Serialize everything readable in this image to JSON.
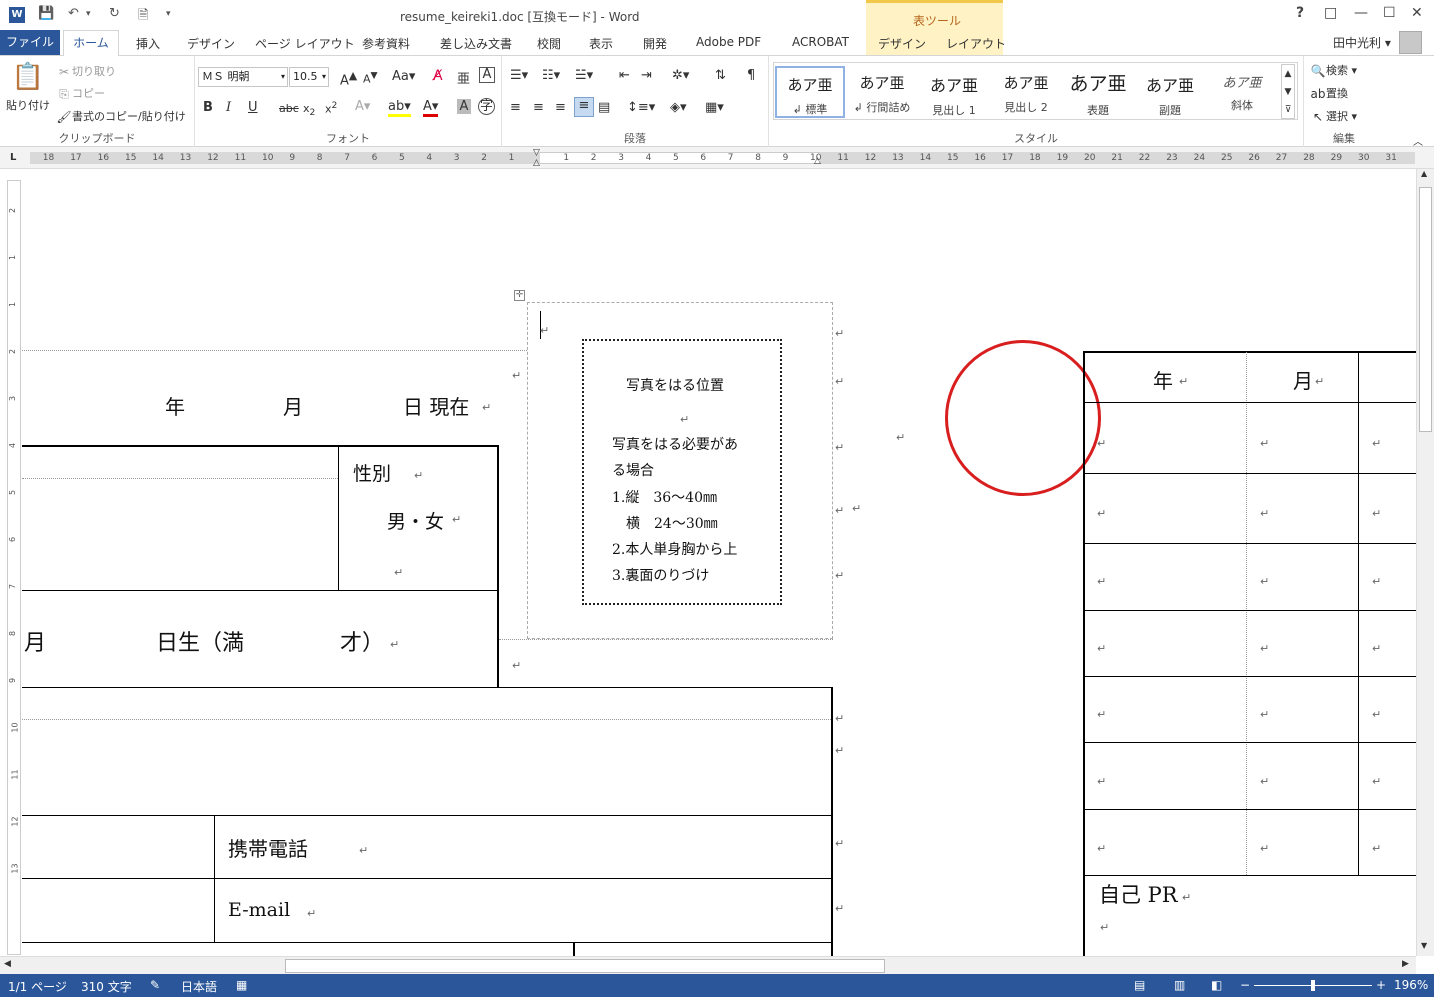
{
  "window": {
    "title": "resume_keireki1.doc [互換モード] - Word",
    "app_icon": "W",
    "controls": {
      "help": "?",
      "restore_ribbon": "□",
      "minimize": "—",
      "maximize": "☐",
      "close": "✕"
    }
  },
  "contextual": {
    "label": "表ツール"
  },
  "tabs": {
    "file": "ファイル",
    "home": "ホーム",
    "insert": "挿入",
    "design": "デザイン",
    "page_layout": "ページ レイアウト",
    "references": "参考資料",
    "mailings": "差し込み文書",
    "review": "校閲",
    "view": "表示",
    "developer": "開発",
    "adobe_pdf": "Adobe PDF",
    "acrobat": "ACROBAT",
    "table_design": "デザイン",
    "table_layout": "レイアウト",
    "user": "田中光利 ▾"
  },
  "ribbon": {
    "clipboard": {
      "paste": "貼り付け",
      "cut": "切り取り",
      "copy": "コピー",
      "format_painter": "書式のコピー/貼り付け",
      "label": "クリップボード"
    },
    "font": {
      "font_name": "ＭＳ 明朝",
      "font_size": "10.5",
      "label": "フォント"
    },
    "paragraph": {
      "label": "段落"
    },
    "styles": {
      "items": [
        {
          "sample": "あア亜",
          "name": "↲ 標準"
        },
        {
          "sample": "あア亜",
          "name": "↲ 行間詰め"
        },
        {
          "sample": "あア亜",
          "name": "見出し 1"
        },
        {
          "sample": "あア亜",
          "name": "見出し 2"
        },
        {
          "sample": "あア亜",
          "name": "表題"
        },
        {
          "sample": "あア亜",
          "name": "副題"
        },
        {
          "sample": "あア亜",
          "name": "斜体"
        }
      ],
      "label": "スタイル"
    },
    "editing": {
      "find": "検索",
      "replace": "置換",
      "select": "選択",
      "label": "編集"
    }
  },
  "ruler": {
    "h_left_ticks": [
      "18",
      "17",
      "16",
      "15",
      "14",
      "13",
      "12",
      "11",
      "10",
      "9",
      "8",
      "7",
      "6",
      "5",
      "4",
      "3",
      "2",
      "1"
    ],
    "h_right_ticks": [
      "1",
      "2",
      "3",
      "4",
      "5",
      "6",
      "7",
      "8",
      "9",
      "10",
      "11",
      "12",
      "13",
      "14",
      "15",
      "16",
      "17",
      "18",
      "19",
      "20",
      "21",
      "22",
      "23",
      "24",
      "25",
      "26",
      "27",
      "28",
      "29",
      "30",
      "31"
    ],
    "v_ticks": [
      "2",
      "1",
      "1",
      "2",
      "3",
      "4",
      "5",
      "6",
      "7",
      "8",
      "9",
      "10",
      "11",
      "12",
      "13"
    ]
  },
  "document": {
    "date_line": {
      "year": "年",
      "month": "月",
      "day": "日 現在"
    },
    "gender_label": "性別",
    "gender_value": "男・女",
    "birth_prefix": "月",
    "birth_text": "日生（満",
    "age_suffix": "才）",
    "mobile_label": "携帯電話",
    "email_label": "E-mail",
    "photo_box": {
      "title": "写真をはる位置",
      "line1": "写真をはる必要があ",
      "line2": "る場合",
      "line3": "1.縦　36～40㎜",
      "line4": "　横　24～30㎜",
      "line5": "2.本人単身胸から上",
      "line6": "3.裏面のりづけ"
    },
    "history_table": {
      "year_header": "年",
      "month_header": "月"
    },
    "self_pr": "自己 PR",
    "para_mark": "↵"
  },
  "status": {
    "page": "1/1 ページ",
    "words": "310 文字",
    "language": "日本語",
    "zoom": "196%",
    "zoom_minus": "−",
    "zoom_plus": "+"
  }
}
